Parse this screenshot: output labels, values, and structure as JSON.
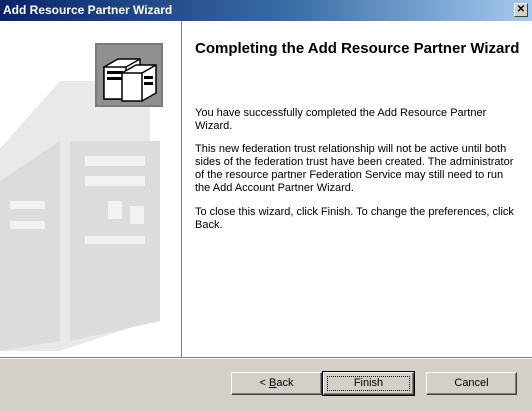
{
  "window": {
    "title": "Add Resource Partner Wizard",
    "close_glyph": "✕"
  },
  "content": {
    "heading": "Completing the Add Resource Partner Wizard",
    "paragraph_1": "You have successfully completed the Add Resource Partner Wizard.",
    "paragraph_2": "This new federation trust relationship will not be active until both sides of the federation trust have been created. The administrator of the resource partner Federation Service may still need to run the Add Account Partner Wizard.",
    "paragraph_3": "To close this wizard, click Finish. To change the preferences, click Back."
  },
  "buttons": {
    "back_prefix": "< ",
    "back_mnemonic": "B",
    "back_rest": "ack",
    "finish": "Finish",
    "cancel": "Cancel"
  },
  "colors": {
    "titlebar_start": "#0a246a",
    "titlebar_end": "#a6caf0",
    "dialog_face": "#d4d0c8"
  },
  "icons": {
    "wizard_graphic": "federation-servers-icon",
    "sidebar_watermark": "server-watermark"
  }
}
